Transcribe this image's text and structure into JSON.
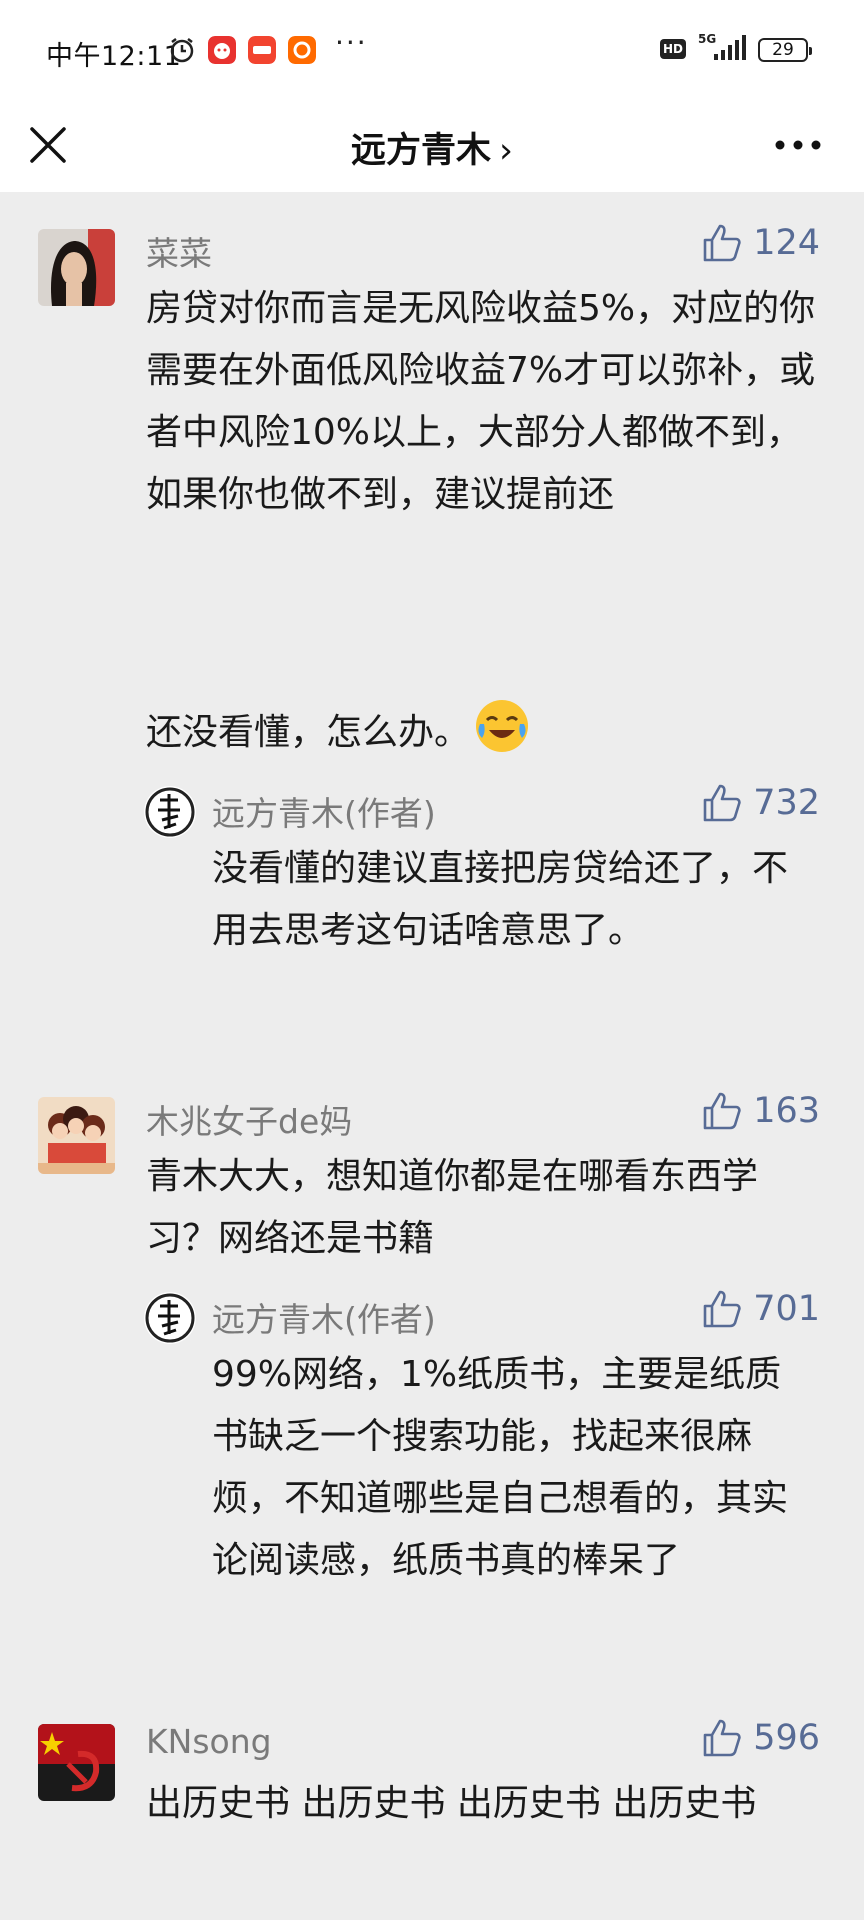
{
  "status_bar": {
    "time": "中午12:11",
    "more": "···",
    "hd": "HD",
    "network": "5G",
    "battery": "29"
  },
  "header": {
    "title": "远方青木",
    "chevron": "›"
  },
  "comments": [
    {
      "user": "菜菜",
      "likes": "124",
      "text": "房贷对你而言是无风险收益5%，对应的你需要在外面低风险收益7%才可以弥补，或者中风险10%以上，大部分人都做不到，如果你也做不到，建议提前还",
      "text2": "还没看懂，怎么办。",
      "reply": {
        "user": "远方青木(作者)",
        "likes": "732",
        "text": "没看懂的建议直接把房贷给还了，不用去思考这句话啥意思了。"
      }
    },
    {
      "user": "木兆女子de妈",
      "likes": "163",
      "text": "青木大大，想知道你都是在哪看东西学习？网络还是书籍",
      "reply": {
        "user": "远方青木(作者)",
        "likes": "701",
        "text": "99%网络，1%纸质书，主要是纸质书缺乏一个搜索功能，找起来很麻烦，不知道哪些是自己想看的，其实论阅读感，纸质书真的棒呆了"
      }
    },
    {
      "user": "KNsong",
      "likes": "596",
      "text": "出历史书 出历史书 出历史书 出历史书"
    }
  ],
  "colors": {
    "accent": "#576b95",
    "background": "#ededed",
    "name": "#7a7a7a"
  }
}
